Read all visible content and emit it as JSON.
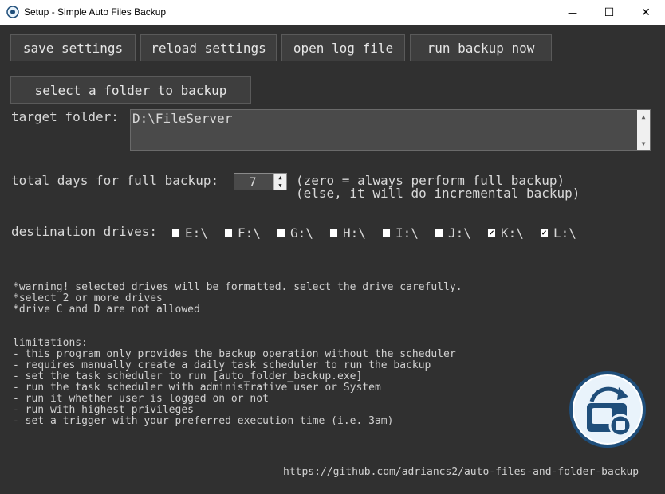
{
  "window": {
    "title": "Setup - Simple Auto Files Backup",
    "minimize_glyph": "—",
    "maximize_glyph": "☐",
    "close_glyph": "✕"
  },
  "toolbar": {
    "save_label": "save settings",
    "reload_label": "reload settings",
    "open_log_label": "open log file",
    "run_backup_label": "run backup now"
  },
  "folder": {
    "select_label": "select a folder to backup",
    "target_label": "target folder:",
    "target_value": "D:\\FileServer"
  },
  "days": {
    "label": "total days for full backup:",
    "value": "7",
    "hint_line1": "(zero = always perform full backup)",
    "hint_line2": "(else, it will do incremental backup)"
  },
  "drives": {
    "label": "destination drives:",
    "items": [
      {
        "label": "E:\\",
        "checked": false
      },
      {
        "label": "F:\\",
        "checked": false
      },
      {
        "label": "G:\\",
        "checked": false
      },
      {
        "label": "H:\\",
        "checked": false
      },
      {
        "label": "I:\\",
        "checked": false
      },
      {
        "label": "J:\\",
        "checked": false
      },
      {
        "label": "K:\\",
        "checked": true
      },
      {
        "label": "L:\\",
        "checked": true
      }
    ]
  },
  "warnings": [
    "*warning! selected drives will be formatted. select the drive carefully.",
    "*select 2 or more drives",
    "*drive C and D are not allowed"
  ],
  "limitations": [
    "limitations:",
    "- this program only provides the backup operation without the scheduler",
    "- requires manually create a daily task scheduler to run the backup",
    "- set the task scheduler to run [auto_folder_backup.exe]",
    "- run the task scheduler with administrative user or System",
    "- run it whether user is logged on or not",
    "- run with highest privileges",
    "- set a trigger with your preferred execution time (i.e. 3am)"
  ],
  "footer": {
    "url": "https://github.com/adriancs2/auto-files-and-folder-backup"
  },
  "colors": {
    "background": "#303030",
    "button": "#3e3e3e",
    "text": "#d8d8d8",
    "logo_ring": "#1f4e7a",
    "logo_fill": "#e9f3fb"
  }
}
